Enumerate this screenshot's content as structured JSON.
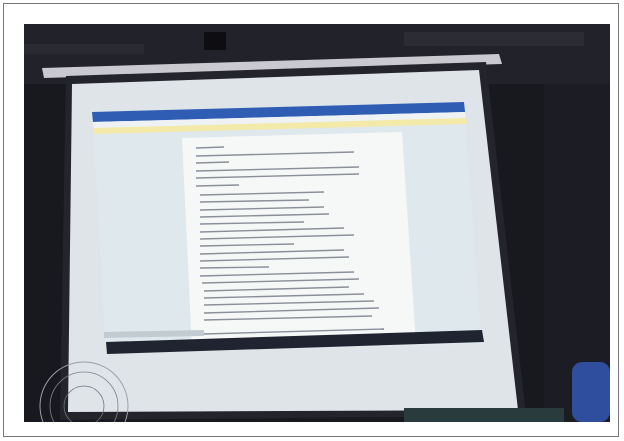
{
  "scene": {
    "description_subject": "projector-screen",
    "colors": {
      "room": "#18181f",
      "screen_housing": "#c9c9cf",
      "screen_surface": "#e6ebee",
      "word_titlebar": "#2f5db3",
      "word_ribbon": "#f2f2f2",
      "word_yellow_bar": "#f3e9a8",
      "document_page": "#f6f8f8",
      "text_lines": "#7a7f88",
      "taskbar": "#1f2430"
    }
  }
}
